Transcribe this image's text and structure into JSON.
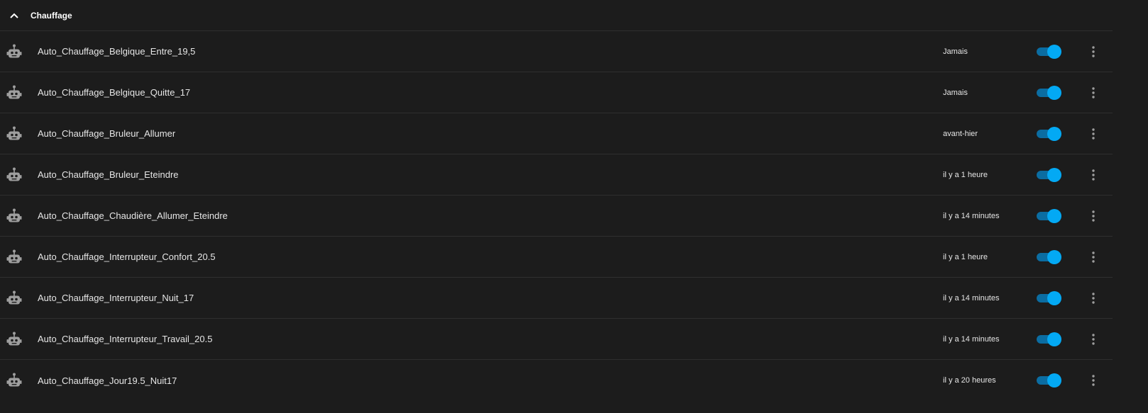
{
  "group": {
    "title": "Chauffage",
    "collapse_icon": "chevron-up-icon"
  },
  "colors": {
    "background": "#1c1c1c",
    "divider": "#2f2f2f",
    "toggle_on_thumb": "#03a9f4",
    "toggle_on_track": "#0b6da2",
    "icon": "#9e9e9e"
  },
  "automations": [
    {
      "name": "Auto_Chauffage_Belgique_Entre_19,5",
      "last_triggered": "Jamais",
      "enabled": true,
      "icon": "robot-icon"
    },
    {
      "name": "Auto_Chauffage_Belgique_Quitte_17",
      "last_triggered": "Jamais",
      "enabled": true,
      "icon": "robot-icon"
    },
    {
      "name": "Auto_Chauffage_Bruleur_Allumer",
      "last_triggered": "avant-hier",
      "enabled": true,
      "icon": "robot-icon"
    },
    {
      "name": "Auto_Chauffage_Bruleur_Eteindre",
      "last_triggered": "il y a 1 heure",
      "enabled": true,
      "icon": "robot-icon"
    },
    {
      "name": "Auto_Chauffage_Chaudière_Allumer_Eteindre",
      "last_triggered": "il y a 14 minutes",
      "enabled": true,
      "icon": "robot-icon"
    },
    {
      "name": "Auto_Chauffage_Interrupteur_Confort_20.5",
      "last_triggered": "il y a 1 heure",
      "enabled": true,
      "icon": "robot-icon"
    },
    {
      "name": "Auto_Chauffage_Interrupteur_Nuit_17",
      "last_triggered": "il y a 14 minutes",
      "enabled": true,
      "icon": "robot-icon"
    },
    {
      "name": "Auto_Chauffage_Interrupteur_Travail_20.5",
      "last_triggered": "il y a 14 minutes",
      "enabled": true,
      "icon": "robot-icon"
    },
    {
      "name": "Auto_Chauffage_Jour19.5_Nuit17",
      "last_triggered": "il y a 20 heures",
      "enabled": true,
      "icon": "robot-icon"
    }
  ]
}
